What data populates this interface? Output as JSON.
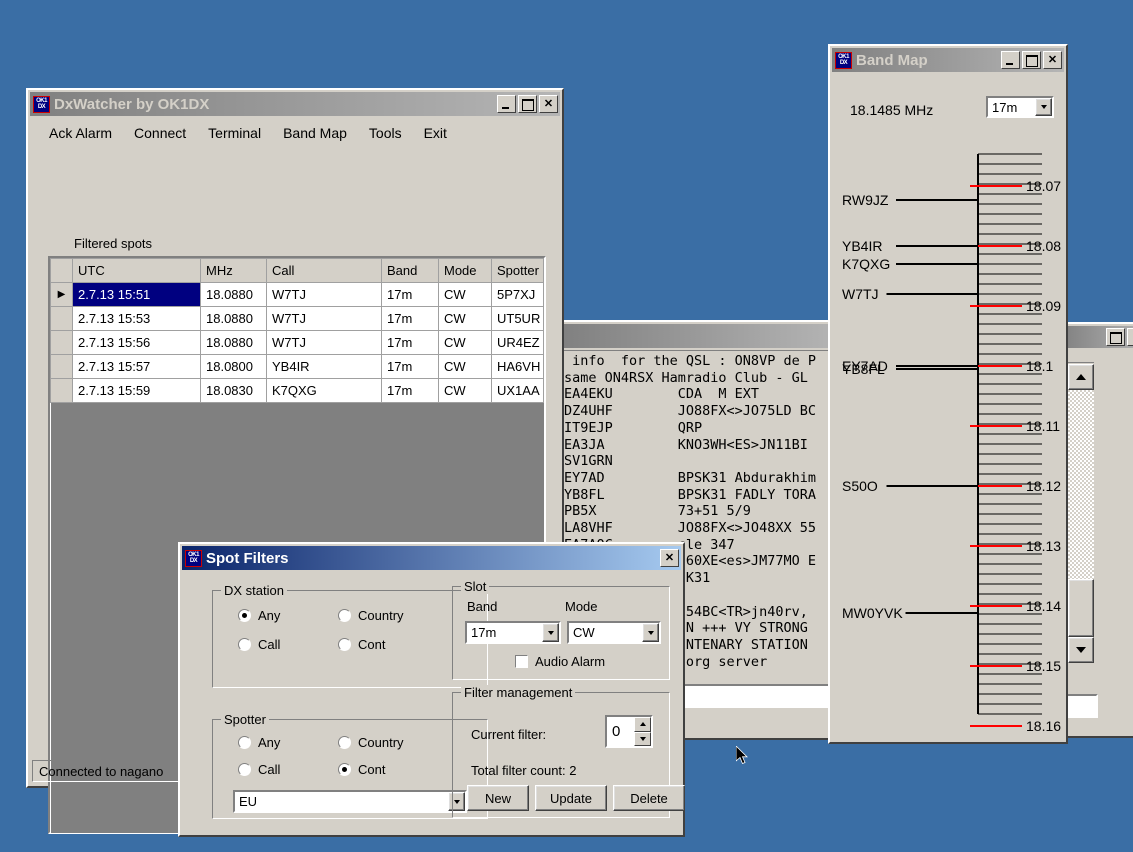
{
  "desktop": {
    "background": "#3a6ea5"
  },
  "dxwatcher": {
    "title": "DxWatcher by OK1DX",
    "icon": "ok1dx-logo-icon",
    "titlebar_buttons": [
      "minimize",
      "maximize",
      "close"
    ],
    "menu": [
      "Ack Alarm",
      "Connect",
      "Terminal",
      "Band Map",
      "Tools",
      "Exit"
    ],
    "section_label": "Filtered spots",
    "columns": [
      "UTC",
      "MHz",
      "Call",
      "Band",
      "Mode",
      "Spotter"
    ],
    "rows": [
      {
        "utc": "2.7.13 15:51",
        "mhz": "18.0880",
        "call": "W7TJ",
        "band": "17m",
        "mode": "CW",
        "spotter": "5P7XJ",
        "selected": true,
        "marker": "▶"
      },
      {
        "utc": "2.7.13 15:53",
        "mhz": "18.0880",
        "call": "W7TJ",
        "band": "17m",
        "mode": "CW",
        "spotter": "UT5UR",
        "selected": false,
        "marker": ""
      },
      {
        "utc": "2.7.13 15:56",
        "mhz": "18.0880",
        "call": "W7TJ",
        "band": "17m",
        "mode": "CW",
        "spotter": "UR4EZ",
        "selected": false,
        "marker": ""
      },
      {
        "utc": "2.7.13 15:57",
        "mhz": "18.0800",
        "call": "YB4IR",
        "band": "17m",
        "mode": "CW",
        "spotter": "HA6VH",
        "selected": false,
        "marker": ""
      },
      {
        "utc": "2.7.13 15:59",
        "mhz": "18.0830",
        "call": "K7QXG",
        "band": "17m",
        "mode": "CW",
        "spotter": "UX1AA",
        "selected": false,
        "marker": ""
      }
    ],
    "status": "Connected to nagano"
  },
  "terminal": {
    "lines": [
      " info  for the QSL : ON8VP de P",
      "same ON4RSX Hamradio Club - GL",
      "EA4EKU        CDA  M EXT",
      "DZ4UHF        JO88FX<>JO75LD BC",
      "IT9EJP        QRP",
      "EA3JA         KNO3WH<ES>JN11BI ",
      "SV1GRN",
      "EY7AD         BPSK31 Abdurakhim",
      "YB8FL         BPSK31 FADLY TORA",
      "PB5X          73+51 5/9",
      "LA8VHF        JO88FX<>JO48XX 55",
      "EA7AOC        cle 347",
      "              060XE<es>JM77MO E",
      "              SK31",
      "",
      "              N54BC<TR>jn40rv,",
      "              NN +++ VY STRONG",
      "              ENTENARY STATION",
      "              .org server"
    ],
    "input_value": ""
  },
  "right_window": {
    "titlebar_buttons": [
      "maximize",
      "close"
    ],
    "scrollbar": {
      "up_arrow": "scroll-up",
      "down_arrow": "scroll-down",
      "thumb_position": "near-bottom"
    },
    "field_value": ""
  },
  "bandmap": {
    "title": "Band Map",
    "icon": "ok1dx-logo-icon",
    "titlebar_buttons": [
      "minimize",
      "maximize",
      "close"
    ],
    "frequency": "18.1485 MHz",
    "band_select": {
      "value": "17m",
      "options": [
        "17m"
      ]
    },
    "scale": {
      "min": 18.065,
      "max": 18.1685,
      "minor_step": 0.00167,
      "labels": [
        "18.07",
        "18.08",
        "18.09",
        "18.1",
        "18.11",
        "18.12",
        "18.13",
        "18.14",
        "18.15",
        "18.16"
      ],
      "label_values": [
        18.07,
        18.08,
        18.09,
        18.1,
        18.11,
        18.12,
        18.13,
        18.14,
        18.15,
        18.16
      ],
      "label_color": "#ff0000"
    },
    "spots": [
      {
        "call": "RW9JZ",
        "freq": 18.0723
      },
      {
        "call": "YB4IR",
        "freq": 18.08
      },
      {
        "call": "K7QXG",
        "freq": 18.083
      },
      {
        "call": "W7TJ",
        "freq": 18.088
      },
      {
        "call": "EY7AD",
        "freq": 18.1
      },
      {
        "call": "YB8FL",
        "freq": 18.1005
      },
      {
        "call": "S50O",
        "freq": 18.12
      },
      {
        "call": "MW0YVK",
        "freq": 18.1412
      }
    ]
  },
  "spot_filters": {
    "title": "Spot Filters",
    "icon": "ok1dx-logo-icon",
    "titlebar_buttons": [
      "close"
    ],
    "dx_station": {
      "legend": "DX station",
      "options": [
        {
          "label": "Any",
          "selected": true
        },
        {
          "label": "Country",
          "selected": false
        },
        {
          "label": "Call",
          "selected": false
        },
        {
          "label": "Cont",
          "selected": false
        }
      ]
    },
    "spotter": {
      "legend": "Spotter",
      "options": [
        {
          "label": "Any",
          "selected": false
        },
        {
          "label": "Country",
          "selected": false
        },
        {
          "label": "Call",
          "selected": false
        },
        {
          "label": "Cont",
          "selected": true
        }
      ],
      "combo": {
        "value": "EU",
        "options": [
          "EU"
        ]
      }
    },
    "slot": {
      "legend": "Slot",
      "band_label": "Band",
      "mode_label": "Mode",
      "band": {
        "value": "17m"
      },
      "mode": {
        "value": "CW"
      },
      "audio_alarm": {
        "label": "Audio Alarm",
        "checked": false
      }
    },
    "filter_management": {
      "legend": "Filter management",
      "current_filter_label": "Current filter:",
      "current_filter_value": "0",
      "total_count_text": "Total filter count: 2",
      "buttons": [
        "New",
        "Update",
        "Delete"
      ]
    }
  }
}
